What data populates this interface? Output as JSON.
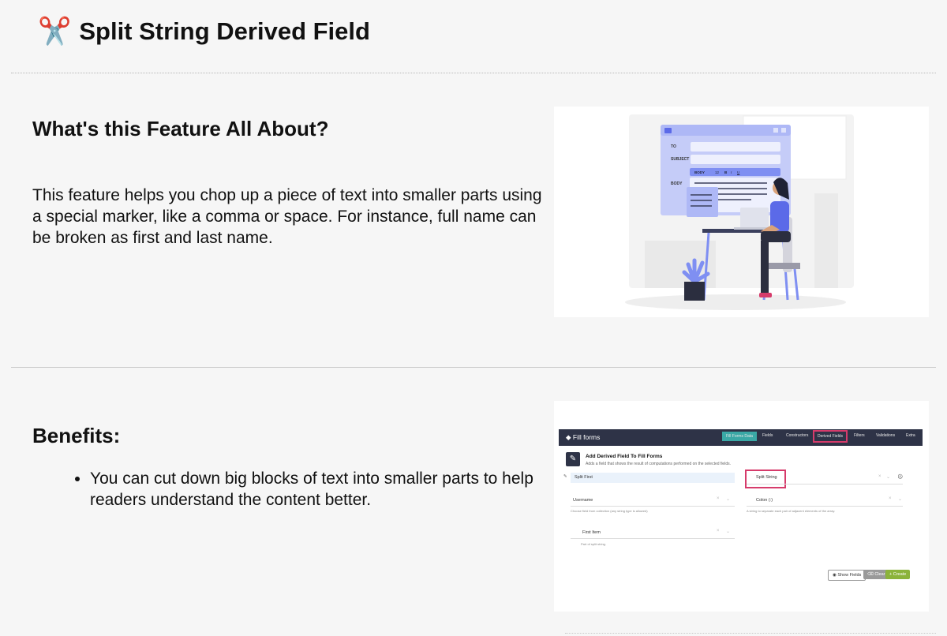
{
  "header": {
    "icon": "scissors-icon",
    "icon_glyph": "✂️",
    "title": "Split String Derived Field"
  },
  "feature": {
    "heading": "What's this Feature All About?",
    "text": "This feature helps you chop up a piece of text into smaller parts using a special marker, like a comma or space. For instance, full name can be broken as first and last name."
  },
  "benefits": {
    "heading": "Benefits:",
    "items": [
      "You can cut down big blocks of text into smaller parts to help readers understand the content better."
    ]
  },
  "illustration": {
    "form_labels": [
      "TO",
      "SUBJECT",
      "BODY"
    ],
    "toolbar": [
      "BODY",
      "12",
      "B",
      "I",
      "U"
    ],
    "accent": "#7f8ff2"
  },
  "app_screenshot": {
    "brand": "Fill forms",
    "tabs": [
      "Fill Forms Data",
      "Fields",
      "Constructors",
      "Derived Fields",
      "Filters",
      "Validations",
      "Extra"
    ],
    "active_tab": "Fill Forms Data",
    "highlighted_tab": "Derived Fields",
    "form_title": "Add Derived Field To Fill Forms",
    "form_subtitle": "Adds a field that shows the result of computations performed on the selected fields.",
    "name_value": "Split First",
    "type_value": "Split String",
    "source_field": "Username",
    "source_help": "Choose field from collection (any string type is allowed)",
    "separator": "Colon (:)",
    "separator_help": "A string to separate each pair of adjacent elements of the array.",
    "item_field": "First Item",
    "item_help": "Part of split string.",
    "buttons": {
      "show_fields": "Show Fields",
      "clear": "Clear",
      "create": "Create"
    },
    "colors": {
      "nav": "#2e3347",
      "active": "#3aa8a6",
      "highlight": "#d63b6b",
      "create": "#8bb33a",
      "clear": "#9a9a9a"
    }
  }
}
